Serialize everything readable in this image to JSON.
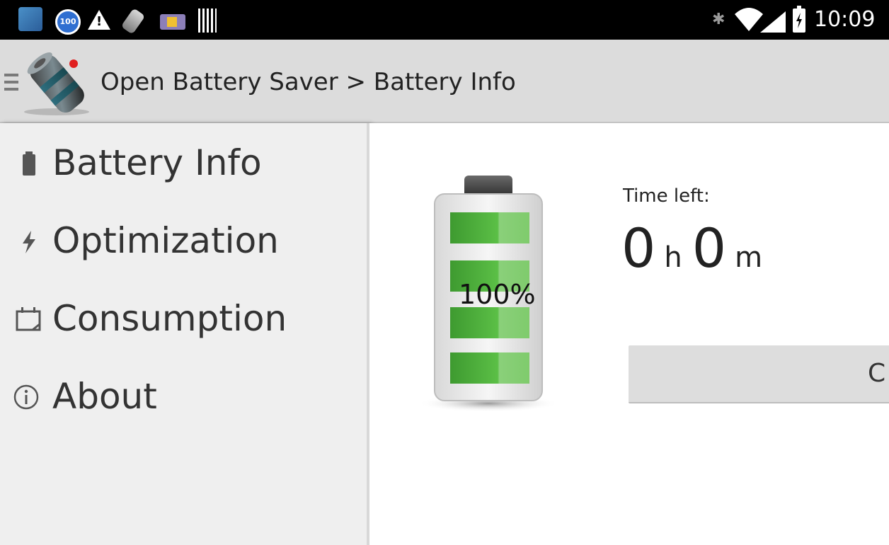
{
  "status_bar": {
    "time": "10:09",
    "notification_icons": [
      "photos-icon",
      "badge-100-icon",
      "warning-icon",
      "battery-tilted-icon",
      "parking-icon",
      "barcode-icon"
    ],
    "badge_text": "100",
    "system_icons": [
      "bluetooth-icon",
      "wifi-icon",
      "signal-icon",
      "battery-charging-icon"
    ]
  },
  "action_bar": {
    "title": "Open Battery Saver > Battery Info",
    "logo_icon": "battery-cylinder-logo"
  },
  "drawer": {
    "items": [
      {
        "label": "Battery Info",
        "icon": "battery-icon"
      },
      {
        "label": "Optimization",
        "icon": "lightning-icon"
      },
      {
        "label": "Consumption",
        "icon": "calendar-icon"
      },
      {
        "label": "About",
        "icon": "info-icon"
      }
    ]
  },
  "content": {
    "battery_percent": "100%",
    "battery_level": 1.0,
    "time_left_label": "Time left:",
    "hours": "0",
    "hours_unit": "h",
    "minutes": "0",
    "minutes_unit": "m",
    "button_label": "C"
  },
  "colors": {
    "action_bar": "#dcdcdc",
    "drawer_bg": "#efefef",
    "battery_green": "#4caf3a",
    "status_bar": "#000000"
  }
}
